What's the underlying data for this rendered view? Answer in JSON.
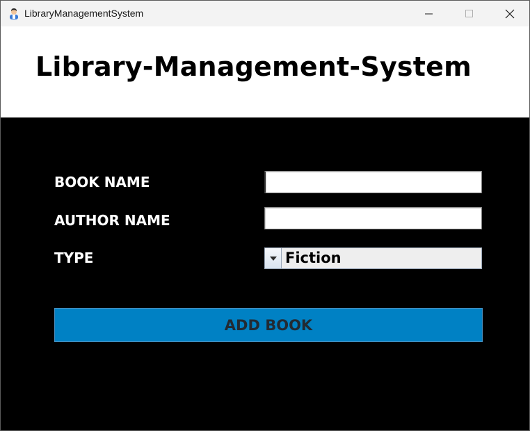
{
  "window": {
    "title": "LibraryManagementSystem",
    "icon": "user-avatar-icon"
  },
  "header": {
    "title": "Library-Management-System"
  },
  "form": {
    "book_name_label": "BOOK NAME",
    "book_name_value": "",
    "author_name_label": "AUTHOR NAME",
    "author_name_value": "",
    "type_label": "TYPE",
    "type_selected": "Fiction"
  },
  "actions": {
    "add_book_label": "ADD BOOK"
  },
  "colors": {
    "background": "#000000",
    "header_background": "#ffffff",
    "button_background": "#0081c4",
    "button_text": "#222a33",
    "label_text": "#ffffff"
  }
}
